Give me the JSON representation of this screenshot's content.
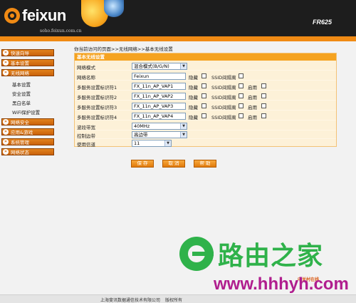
{
  "header": {
    "brand": "feixun",
    "url": "soho.feixun.com.cn",
    "model": "FR625"
  },
  "sidebar": {
    "groups": [
      {
        "label": "快速向导"
      },
      {
        "label": "基本设置"
      },
      {
        "label": "无线网络"
      },
      {
        "label": "网络安全"
      },
      {
        "label": "应用&游戏"
      },
      {
        "label": "系统管理"
      },
      {
        "label": "网络状态"
      }
    ],
    "wireless_items": [
      {
        "label": "基本设置"
      },
      {
        "label": "安全设置"
      },
      {
        "label": "黑白名单"
      },
      {
        "label": "WiFi保护设置"
      }
    ]
  },
  "breadcrumb": "你当前访问的页面>>无线网络>>基本无线设置",
  "panel": {
    "title": "基本无线设置",
    "network_mode": {
      "label": "网络模式",
      "value": "混合模式(B/G/N)"
    },
    "ssid": {
      "label": "网络名称",
      "value": "Feixun",
      "hide": "隐藏",
      "isolate": "SSID间隔离"
    },
    "multi_ssid": [
      {
        "label": "多服务设置标识符1",
        "value": "FX_11n_AP_VAP1"
      },
      {
        "label": "多服务设置标识符2",
        "value": "FX_11n_AP_VAP2"
      },
      {
        "label": "多服务设置标识符3",
        "value": "FX_11n_AP_VAP3"
      },
      {
        "label": "多服务设置标识符4",
        "value": "FX_11n_AP_VAP4"
      }
    ],
    "hide_label": "隐藏",
    "isolate_label": "SSID间隔离",
    "enable_label": "启用",
    "bandwidth": {
      "label": "波段带宽",
      "value": "40MHz"
    },
    "control_band": {
      "label": "控制边带",
      "value": "高边带"
    },
    "channel": {
      "label": "使用信道",
      "value": "11"
    }
  },
  "buttons": {
    "save": "保 存",
    "cancel": "取 消",
    "help": "帮 助"
  },
  "watermark": {
    "cn": "路由之家",
    "site": "www.hhhyh.com",
    "zol": "中关村在线"
  },
  "footer": {
    "company": "上海斐讯数据通信技术有限公司",
    "rights": "版权所有"
  }
}
